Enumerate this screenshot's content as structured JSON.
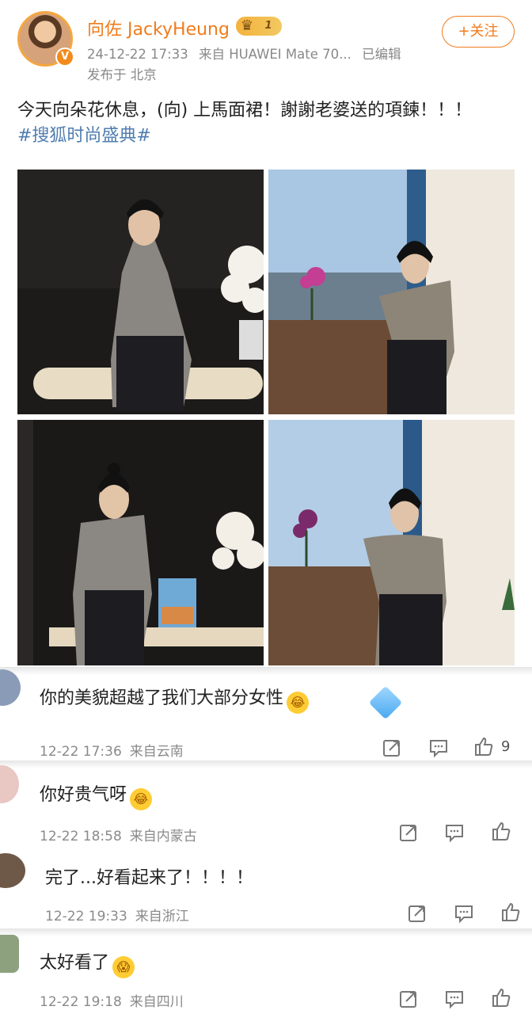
{
  "post": {
    "username": "向佐 JackyHeung",
    "badge_level": "1",
    "avatar_badge": "V",
    "timestamp": "24-12-22 17:33",
    "source": "来自 HUAWEI Mate 70...",
    "edited": "已编辑",
    "location": "发布于 北京",
    "follow_label": "+关注",
    "text": "今天向朵花休息，(向) 上馬面裙！謝謝老婆送的項鍊！！！",
    "hashtag": "#搜狐时尚盛典#",
    "photos": [
      "photo-1",
      "photo-2",
      "photo-3",
      "photo-4"
    ]
  },
  "comments": [
    {
      "text": "你的美貌超越了我们大部分女性",
      "time": "12-22 17:36",
      "region": "来自云南",
      "likes": "9",
      "emoji": "laugh-cry-emoji"
    },
    {
      "text": "你好贵气呀",
      "time": "12-22 18:58",
      "region": "来自内蒙古",
      "likes": "",
      "emoji": "laugh-cry-emoji"
    },
    {
      "text": "完了...好看起来了！！！！",
      "time": "12-22 19:33",
      "region": "来自浙江",
      "likes": "",
      "emoji": ""
    },
    {
      "text": "太好看了",
      "time": "12-22 19:18",
      "region": "来自四川",
      "likes": "",
      "emoji": "screaming-emoji"
    }
  ],
  "icons": {
    "repost": "repost-icon",
    "comment": "comment-icon",
    "like": "thumbs-up-icon"
  },
  "colors": {
    "accent": "#f07c1c",
    "hashtag": "#507daf",
    "meta": "#888888"
  }
}
